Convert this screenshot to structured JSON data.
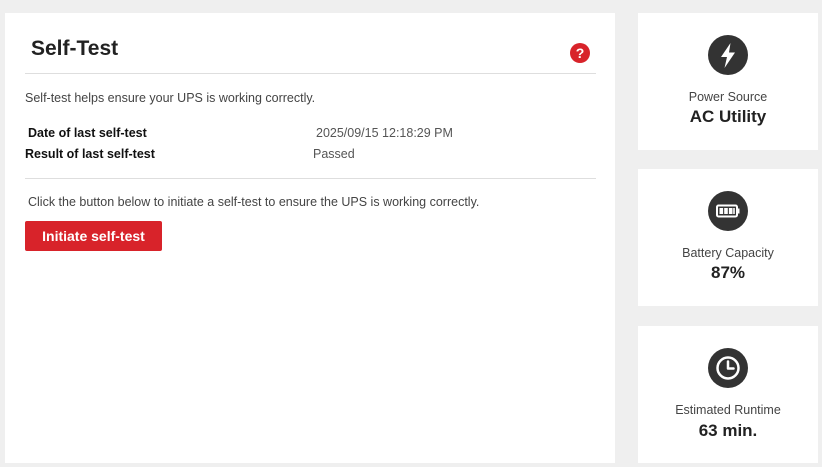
{
  "self_test": {
    "title": "Self-Test",
    "help_icon": "question-mark",
    "description": "Self-test helps ensure your UPS is working correctly.",
    "last_date_label": "Date of last self-test",
    "last_date_value": "2025/09/15 12:18:29 PM",
    "last_result_label": "Result of last self-test",
    "last_result_value": "Passed",
    "instruction": "Click the button below to initiate a self-test to ensure the UPS is working correctly.",
    "initiate_button_label": "Initiate self-test"
  },
  "status_cards": [
    {
      "icon": "lightning-bolt-icon",
      "label": "Power Source",
      "value": "AC Utility"
    },
    {
      "icon": "battery-icon",
      "label": "Battery Capacity",
      "value": "87%"
    },
    {
      "icon": "clock-icon",
      "label": "Estimated Runtime",
      "value": "63 min."
    }
  ],
  "colors": {
    "accent": "#d8232a",
    "background": "#efefef",
    "panel": "#ffffff",
    "icon_circle": "#333333"
  }
}
